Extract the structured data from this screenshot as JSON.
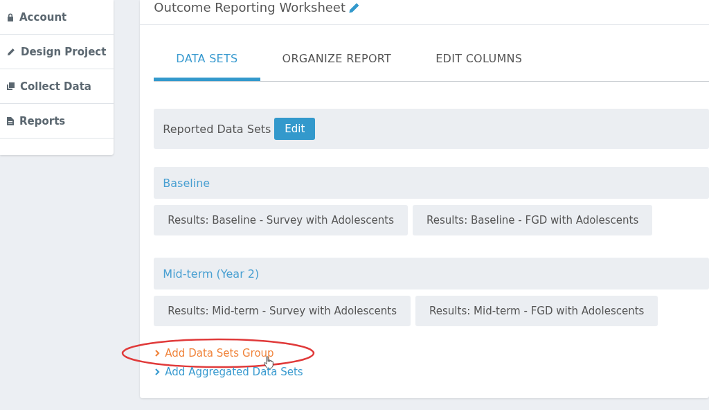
{
  "sidebar": {
    "items": [
      {
        "label": "Account",
        "kind": "lock"
      },
      {
        "label": "Design Project",
        "kind": "pencil"
      },
      {
        "label": "Collect Data",
        "kind": "copy"
      },
      {
        "label": "Reports",
        "kind": "file"
      }
    ]
  },
  "worksheet": {
    "title": "Outcome Reporting Worksheet",
    "tabs": [
      {
        "label": "DATA SETS",
        "selected": true
      },
      {
        "label": "ORGANIZE REPORT",
        "selected": false
      },
      {
        "label": "EDIT COLUMNS",
        "selected": false
      }
    ],
    "reported": {
      "label": "Reported Data Sets",
      "button": "Edit"
    },
    "groups": [
      {
        "name": "Baseline",
        "data_sets": [
          "Results: Baseline - Survey with Adolescents",
          "Results: Baseline - FGD with Adolescents"
        ]
      },
      {
        "name": "Mid-term (Year 2)",
        "data_sets": [
          "Results: Mid-term - Survey with Adolescents",
          "Results: Mid-term - FGD with Adolescents"
        ]
      }
    ],
    "links": [
      {
        "label": "Add Data Sets Group",
        "hovered": true,
        "circled": true
      },
      {
        "label": "Add Aggregated Data Sets",
        "hovered": false,
        "circled": false
      }
    ]
  }
}
